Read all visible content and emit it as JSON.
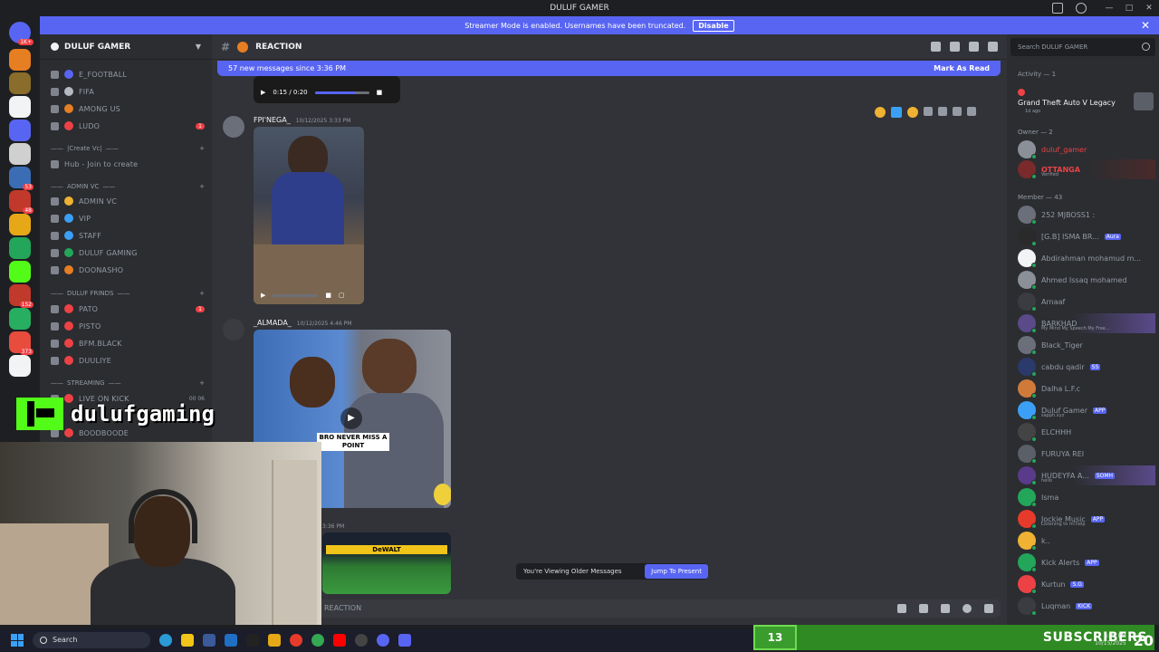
{
  "window": {
    "title": "DULUF GAMER"
  },
  "banner": {
    "text": "Streamer Mode is enabled. Usernames have been truncated.",
    "button": "Disable"
  },
  "server": {
    "name": "DULUF GAMER"
  },
  "channels": [
    {
      "label": "E_FOOTBALL",
      "emoji_color": "#5865f2",
      "unread": ""
    },
    {
      "label": "FIFA",
      "emoji_color": "#b5bac1",
      "unread": ""
    },
    {
      "label": "AMONG US",
      "emoji_color": "#e67e22",
      "unread": ""
    },
    {
      "label": "LUDO",
      "emoji_color": "#ed4245",
      "unread": "1"
    }
  ],
  "categories": {
    "create_vc": "|Create Vc|",
    "admin_vc": "ADMIN VC",
    "duluf_frinds": "DULUF FRINDS",
    "streaming": "STREAMING"
  },
  "hub": "Hub - Join to create",
  "admin_channels": [
    {
      "label": "ADMIN VC",
      "emoji_color": "#f0b232"
    },
    {
      "label": "VIP",
      "emoji_color": "#3ba0f5"
    },
    {
      "label": "STAFF",
      "emoji_color": "#3ba0f5"
    },
    {
      "label": "DULUF GAMING",
      "emoji_color": "#23a55a"
    },
    {
      "label": "DOONASHO",
      "emoji_color": "#e67e22"
    }
  ],
  "frind_channels": [
    {
      "label": "PATO",
      "unread": "1"
    },
    {
      "label": "PISTO",
      "unread": ""
    },
    {
      "label": "BFM.BLACK",
      "unread": ""
    },
    {
      "label": "DUULIYE",
      "unread": ""
    }
  ],
  "stream_channels": [
    {
      "label": "LIVE ON KICK",
      "extra": "00 06"
    },
    {
      "label": "BOODBOODE",
      "extra": ""
    }
  ],
  "chat": {
    "channel_name": "REACTION",
    "new_messages": "57 new messages since 3:36 PM",
    "mark_as_read": "Mark As Read",
    "top_video_time": "0:15 / 0:20",
    "top_video_progress": 0.75,
    "messages": [
      {
        "user": "FPI'NEGA_",
        "time": "10/12/2025 3:33 PM"
      },
      {
        "user": "_ALMADA_",
        "time": "10/12/2025 4:46 PM"
      }
    ],
    "video2_caption": "BRO NEVER MISS A POINT",
    "third_time": "3:36 PM",
    "third_caption": "DeWALT",
    "older_notice": "You're Viewing Older Messages",
    "jump_button": "Jump To Present",
    "composer_placeholder": "REACTION"
  },
  "members": {
    "search_placeholder": "Search DULUF GAMER",
    "activity_label": "Activity — 1",
    "activity_game": "Grand Theft Auto V Legacy",
    "activity_ago": "1d ago",
    "owner_label": "Owner — 2",
    "owners": [
      {
        "name": "duluf_gamer",
        "color": "#ed4245",
        "sub": ""
      },
      {
        "name": "OTTANGA",
        "color": "#ed4245",
        "sub": "Verified"
      }
    ],
    "member_label": "Member — 43",
    "list": [
      {
        "name": "252 MJBOSS1 :",
        "tag": "",
        "sub": ""
      },
      {
        "name": "[G.B] ISMA BR...",
        "tag": "Aura",
        "sub": ""
      },
      {
        "name": "Abdirahman mohamud m...",
        "tag": "",
        "sub": ""
      },
      {
        "name": "Ahmed Issaq mohamed",
        "tag": "",
        "sub": ""
      },
      {
        "name": "Arnaaf",
        "tag": "",
        "sub": ""
      },
      {
        "name": "BARKHAD",
        "tag": "",
        "sub": "My Mind My Speech My Free..."
      },
      {
        "name": "Black_Tiger",
        "tag": "",
        "sub": ""
      },
      {
        "name": "cabdu qadir",
        "tag": "SS",
        "sub": ""
      },
      {
        "name": "Dalha L.F.c",
        "tag": "",
        "sub": ""
      },
      {
        "name": "Duluf Gamer",
        "tag": "APP",
        "sub": "sapph.xyz"
      },
      {
        "name": "ELCHHH",
        "tag": "",
        "sub": ""
      },
      {
        "name": "FURUYA REI",
        "tag": "",
        "sub": ""
      },
      {
        "name": "HUDEYFA A...",
        "tag": "SOMH",
        "sub": "hello"
      },
      {
        "name": "Isma",
        "tag": "",
        "sub": ""
      },
      {
        "name": "Jockie Music",
        "tag": "APP",
        "sub": "Listening to m!help"
      },
      {
        "name": "k..",
        "tag": "",
        "sub": ""
      },
      {
        "name": "Kick Alerts",
        "tag": "APP",
        "sub": ""
      },
      {
        "name": "Kurtun",
        "tag": "S.G",
        "sub": ""
      },
      {
        "name": "Luqman",
        "tag": "KICK",
        "sub": ""
      }
    ]
  },
  "overlay": {
    "kick_name": "dulufgaming",
    "sub_count": "13",
    "sub_label": "SUBSCRIBERS"
  },
  "taskbar": {
    "search": "Search",
    "clock_time": "4:35 PM",
    "clock_date": "10/15/2025",
    "clock_big": "20"
  },
  "colors": {
    "brand": "#5865f2",
    "kick_green": "#53fc18",
    "online": "#23a55a"
  }
}
